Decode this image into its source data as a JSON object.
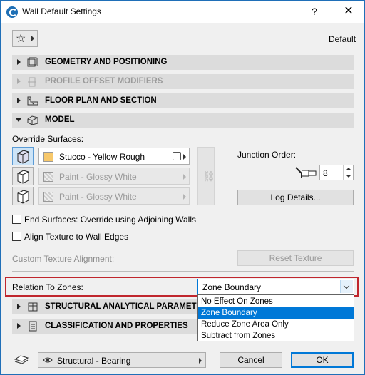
{
  "window": {
    "title": "Wall Default Settings",
    "help": "?",
    "close": "✕"
  },
  "favorites": {
    "star_glyph": "☆",
    "preset_label": "Default"
  },
  "sections": {
    "geometry": "GEOMETRY AND POSITIONING",
    "profile": "PROFILE OFFSET MODIFIERS",
    "floorplan": "FLOOR PLAN AND SECTION",
    "model": "MODEL",
    "structural": "STRUCTURAL ANALYTICAL PARAMETERS",
    "classification": "CLASSIFICATION AND PROPERTIES"
  },
  "model": {
    "override_surfaces_label": "Override Surfaces:",
    "surfaces": [
      {
        "name": "Stucco - Yellow Rough",
        "swatch": "#f7c86b",
        "enabled": true
      },
      {
        "name": "Paint - Glossy White",
        "swatch": "#ffffff",
        "enabled": false
      },
      {
        "name": "Paint - Glossy White",
        "swatch": "#ffffff",
        "enabled": false
      }
    ],
    "junction_order_label": "Junction Order:",
    "junction_order_value": "8",
    "log_details_button": "Log Details...",
    "end_surfaces_label": "End Surfaces: Override using Adjoining Walls",
    "align_texture_label": "Align Texture to Wall Edges",
    "custom_texture_label": "Custom Texture Alignment:",
    "reset_texture_button": "Reset Texture",
    "relation_label": "Relation To Zones:",
    "relation_value": "Zone Boundary",
    "relation_options": [
      "No Effect On Zones",
      "Zone Boundary",
      "Reduce Zone Area Only",
      "Subtract from Zones"
    ],
    "relation_selected_index": 1
  },
  "footer": {
    "structural_function": "Structural - Bearing",
    "cancel_button": "Cancel",
    "ok_button": "OK"
  },
  "colors": {
    "accent": "#0078d7",
    "highlight_border": "#c0262d"
  }
}
